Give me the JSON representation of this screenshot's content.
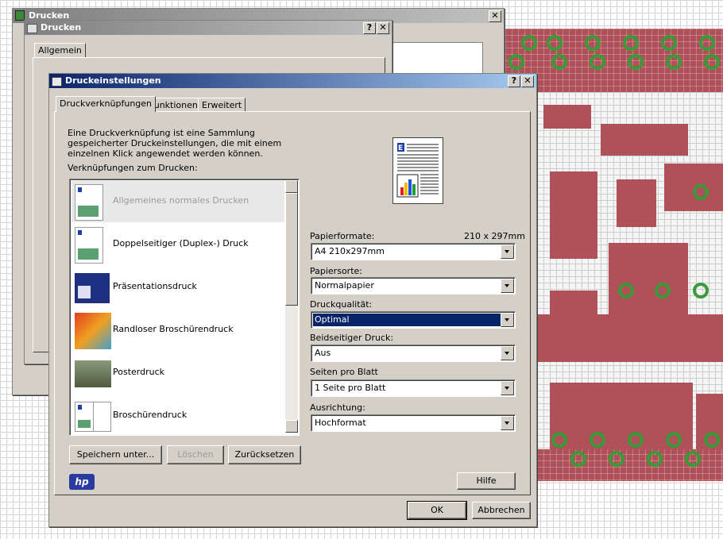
{
  "background_window": {
    "title": "Drucken"
  },
  "mid_window": {
    "title": "Drucken",
    "tab": "Allgemein"
  },
  "dialog": {
    "title": "Druckeinstellungen",
    "help_btn": "?",
    "close_btn": "✕",
    "tabs": [
      "Druckverknüpfungen",
      "Funktionen",
      "Erweitert"
    ],
    "description": "Eine Druckverknüpfung ist eine Sammlung gespeicherter Druckeinstellungen, die mit einem einzelnen Klick angewendet werden können.",
    "shortcuts_label": "Verknüpfungen zum Drucken:",
    "shortcuts": [
      "Allgemeines normales Drucken",
      "Doppelseitiger (Duplex-) Druck",
      "Präsentationsdruck",
      "Randloser Broschürendruck",
      "Posterdruck",
      "Broschürendruck"
    ],
    "paper_size_label": "Papierformate:",
    "paper_size_dims": "210 x 297mm",
    "paper_size_value": "A4 210x297mm",
    "paper_type_label": "Papiersorte:",
    "paper_type_value": "Normalpapier",
    "quality_label": "Druckqualität:",
    "quality_value": "Optimal",
    "duplex_label": "Beidseitiger Druck:",
    "duplex_value": "Aus",
    "pages_label": "Seiten pro Blatt",
    "pages_label_full": "Seiten pro Blatt",
    "pages_value": "1 Seite pro Blatt",
    "orientation_label": "Ausrichtung:",
    "orientation_value": "Hochformat",
    "save_btn": "Speichern unter...",
    "delete_btn": "Löschen",
    "reset_btn": "Zurücksetzen",
    "hp_logo": "hp",
    "help_button": "Hilfe",
    "ok_btn": "OK",
    "cancel_btn": "Abbrechen"
  }
}
